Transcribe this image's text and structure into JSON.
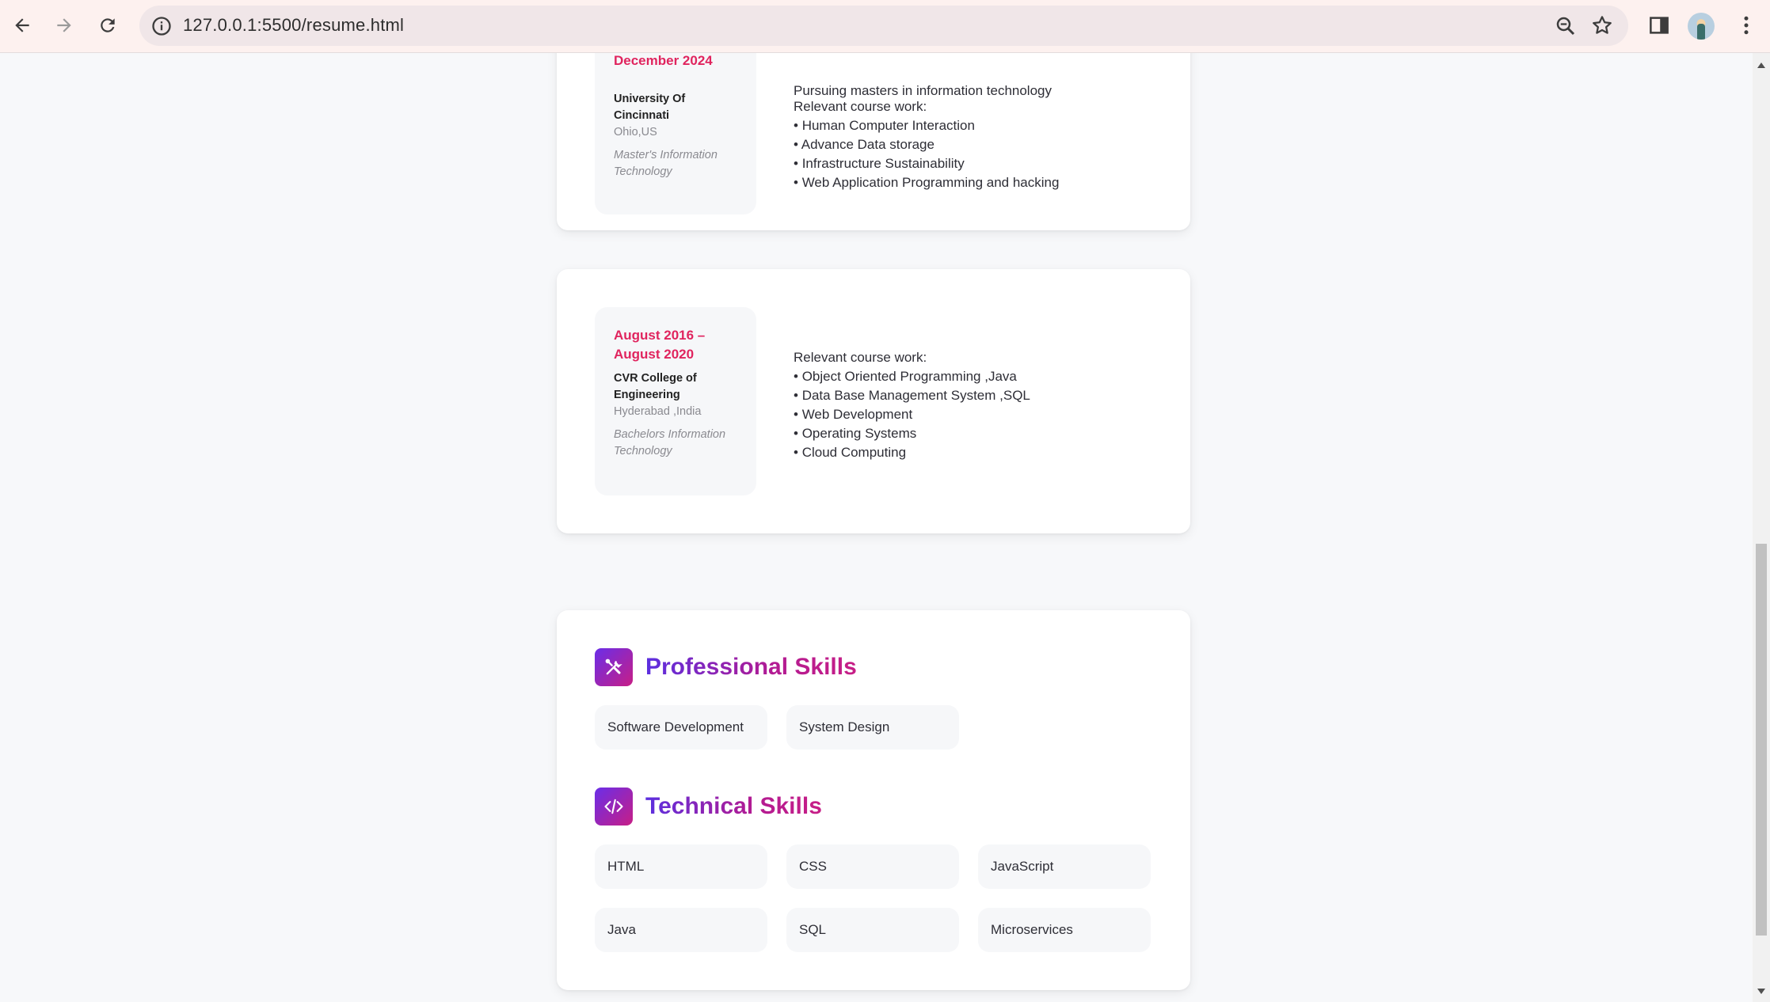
{
  "browser": {
    "url": "127.0.0.1:5500/resume.html"
  },
  "education": [
    {
      "date_partial": "December 2024",
      "school": "University Of Cincinnati",
      "location": "Ohio,US",
      "degree": "Master's Information Technology",
      "intro_partial": "Pursuing masters in information technology",
      "course_label": "Relevant course work:",
      "courses": [
        "Human Computer Interaction",
        "Advance Data storage",
        "Infrastructure Sustainability",
        "Web Application Programming and hacking"
      ]
    },
    {
      "date": "August 2016 – August 2020",
      "school": "CVR College of Engineering",
      "location": "Hyderabad ,India",
      "degree": "Bachelors Information Technology",
      "course_label": "Relevant course work:",
      "courses": [
        "Object Oriented Programming ,Java",
        "Data Base Management System ,SQL",
        "Web Development",
        "Operating Systems",
        "Cloud Computing"
      ]
    }
  ],
  "skills": {
    "professional": {
      "title": "Professional Skills",
      "icon": "tools-icon",
      "items": [
        "Software Development",
        "System Design"
      ]
    },
    "technical": {
      "title": "Technical Skills",
      "icon": "code-icon",
      "items": [
        "HTML",
        "CSS",
        "JavaScript",
        "Java",
        "SQL",
        "Microservices"
      ]
    }
  },
  "colors": {
    "accent_date": "#e0245e",
    "gradient_start": "#6a2ee8",
    "gradient_end": "#c71e86"
  }
}
